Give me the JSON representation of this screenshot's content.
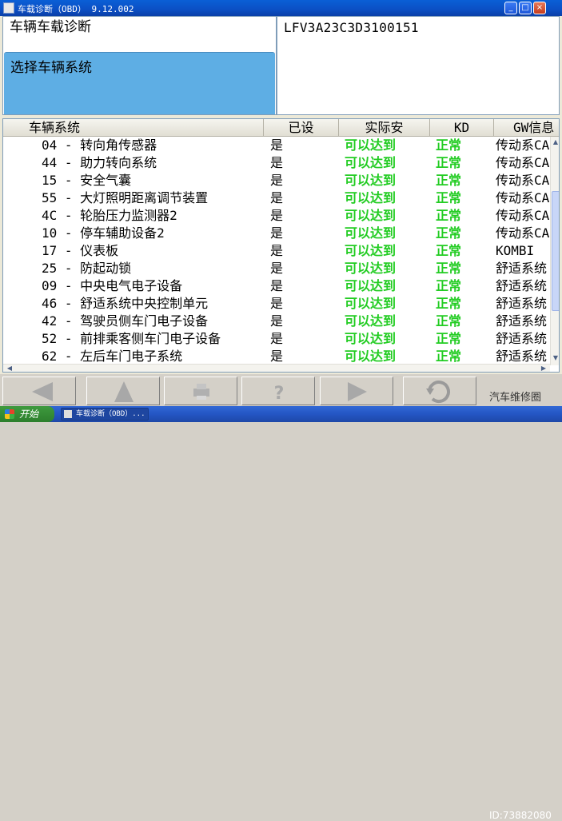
{
  "window": {
    "title": "车载诊断（OBD） 9.12.002",
    "min_label": "_",
    "max_label": "□",
    "close_label": "×"
  },
  "left_pane": {
    "header": "车辆车载诊断",
    "selected": "选择车辆系统"
  },
  "right_pane": {
    "vin": "LFV3A23C3D3100151"
  },
  "table": {
    "columns": [
      "车辆系统",
      "已设",
      "实际安",
      "KD",
      "GW信息"
    ],
    "rows": [
      {
        "system": "04 - 转向角传感器",
        "set": "是",
        "actual": "可以达到",
        "kd": "正常",
        "gw": "传动系CAN"
      },
      {
        "system": "44 - 助力转向系统",
        "set": "是",
        "actual": "可以达到",
        "kd": "正常",
        "gw": "传动系CAN"
      },
      {
        "system": "15 - 安全气囊",
        "set": "是",
        "actual": "可以达到",
        "kd": "正常",
        "gw": "传动系CAN"
      },
      {
        "system": "55 - 大灯照明距离调节装置",
        "set": "是",
        "actual": "可以达到",
        "kd": "正常",
        "gw": "传动系CAN"
      },
      {
        "system": "4C - 轮胎压力监测器2",
        "set": "是",
        "actual": "可以达到",
        "kd": "正常",
        "gw": "传动系CAN"
      },
      {
        "system": "10 - 停车辅助设备2",
        "set": "是",
        "actual": "可以达到",
        "kd": "正常",
        "gw": "传动系CAN"
      },
      {
        "system": "17 - 仪表板",
        "set": "是",
        "actual": "可以达到",
        "kd": "正常",
        "gw": "KOMBI"
      },
      {
        "system": "25 - 防起动锁",
        "set": "是",
        "actual": "可以达到",
        "kd": "正常",
        "gw": "舒适系统"
      },
      {
        "system": "09 - 中央电气电子设备",
        "set": "是",
        "actual": "可以达到",
        "kd": "正常",
        "gw": "舒适系统"
      },
      {
        "system": "46 - 舒适系统中央控制单元",
        "set": "是",
        "actual": "可以达到",
        "kd": "正常",
        "gw": "舒适系统"
      },
      {
        "system": "42 - 驾驶员侧车门电子设备",
        "set": "是",
        "actual": "可以达到",
        "kd": "正常",
        "gw": "舒适系统"
      },
      {
        "system": "52 - 前排乘客侧车门电子设备",
        "set": "是",
        "actual": "可以达到",
        "kd": "正常",
        "gw": "舒适系统"
      },
      {
        "system": "62 - 左后车门电子系统",
        "set": "是",
        "actual": "可以达到",
        "kd": "正常",
        "gw": "舒适系统"
      }
    ]
  },
  "toolbar": {
    "buttons": [
      "back-icon",
      "up-icon",
      "print-icon",
      "help-icon",
      "forward-icon",
      "refresh-icon"
    ]
  },
  "watermark": {
    "text": "汽车维修圈",
    "id": "ID:73882080"
  },
  "taskbar": {
    "start_label": "开始",
    "task_label": "车载诊断（OBD）..."
  },
  "colors": {
    "status_green": "#22cc22",
    "selection_blue": "#5eaee4",
    "titlebar_blue": "#0b4fc4"
  }
}
